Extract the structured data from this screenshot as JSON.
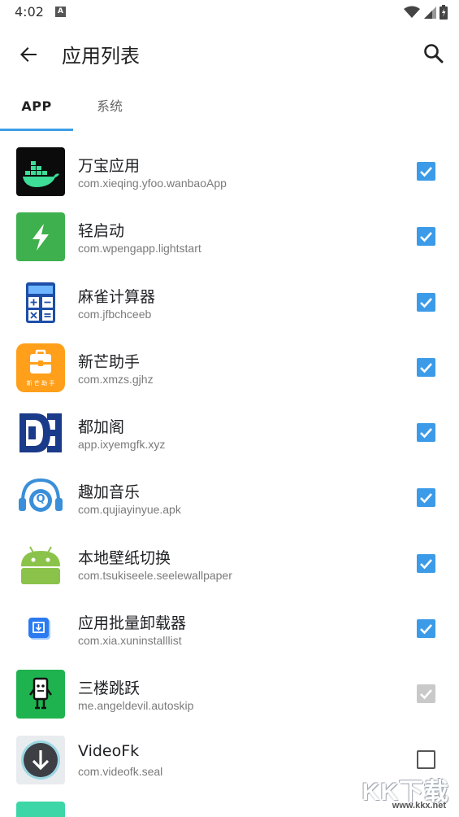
{
  "status_bar": {
    "time": "4:02",
    "notif_letter": "A"
  },
  "app_bar": {
    "title": "应用列表"
  },
  "tabs": [
    {
      "label": "APP",
      "active": true
    },
    {
      "label": "系统",
      "active": false
    }
  ],
  "apps": [
    {
      "name": "万宝应用",
      "package": "com.xieqing.yfoo.wanbaoApp",
      "icon": "docker-whale-icon",
      "checked": "on"
    },
    {
      "name": "轻启动",
      "package": "com.wpengapp.lightstart",
      "icon": "lightning-icon",
      "checked": "on"
    },
    {
      "name": "麻雀计算器",
      "package": "com.jfbchceeb",
      "icon": "calculator-icon",
      "checked": "on"
    },
    {
      "name": "新芒助手",
      "package": "com.xmzs.gjhz",
      "icon": "briefcase-icon",
      "checked": "on",
      "icon_caption": "新 芒 助 手"
    },
    {
      "name": "都加阁",
      "package": "app.ixyemgfk.xyz",
      "icon": "dg-logo-icon",
      "checked": "on"
    },
    {
      "name": "趣加音乐",
      "package": "com.qujiayinyue.apk",
      "icon": "headphones-icon",
      "checked": "on",
      "icon_letter": "Q"
    },
    {
      "name": "本地壁纸切换",
      "package": "com.tsukiseele.seelewallpaper",
      "icon": "android-robot-icon",
      "checked": "on"
    },
    {
      "name": "应用批量卸载器",
      "package": "com.xia.xuninstalllist",
      "icon": "uninstall-icon",
      "checked": "on"
    },
    {
      "name": "三楼跳跃",
      "package": "me.angeldevil.autoskip",
      "icon": "robot-skip-icon",
      "checked": "disabled"
    },
    {
      "name": "VideoFk",
      "package": "com.videofk.seal",
      "icon": "download-arrow-icon",
      "checked": "off"
    }
  ],
  "watermark": {
    "text": "KK下载",
    "url": "www.kkx.net"
  },
  "colors": {
    "accent": "#3c9be8",
    "tab_indicator": "#3d9ee6"
  }
}
